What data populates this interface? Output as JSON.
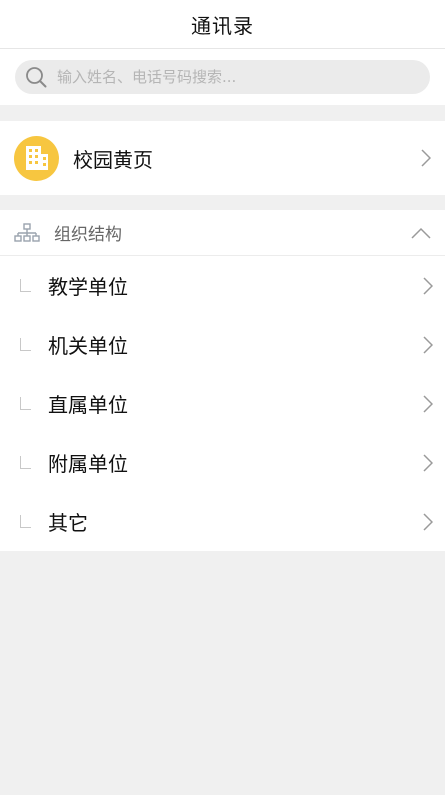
{
  "header": {
    "title": "通讯录"
  },
  "search": {
    "placeholder": "输入姓名、电话号码搜索..."
  },
  "yellow_pages": {
    "label": "校园黄页",
    "icon": "building-icon",
    "icon_color": "#f7c640"
  },
  "org": {
    "title": "组织结构",
    "icon": "org-chart-icon",
    "collapse_icon": "chevron-up-icon",
    "items": [
      {
        "label": "教学单位"
      },
      {
        "label": "机关单位"
      },
      {
        "label": "直属单位"
      },
      {
        "label": "附属单位"
      },
      {
        "label": "其它"
      }
    ]
  }
}
